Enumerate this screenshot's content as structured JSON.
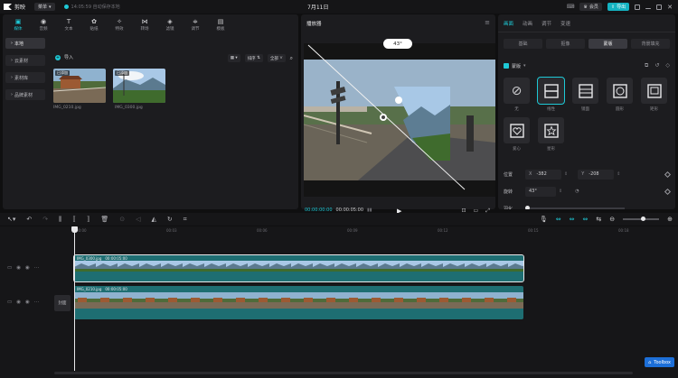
{
  "app": {
    "name": "剪映",
    "menu_label": "菜单",
    "autosave": "14:05:59 自动保存本地",
    "project_title": "7月11日",
    "member_label": "会员",
    "export_label": "导出"
  },
  "media": {
    "tabs": [
      {
        "label": "媒体",
        "glyph": "▣"
      },
      {
        "label": "音频",
        "glyph": "◉"
      },
      {
        "label": "文本",
        "glyph": "T"
      },
      {
        "label": "贴纸",
        "glyph": "✿"
      },
      {
        "label": "特效",
        "glyph": "✧"
      },
      {
        "label": "转场",
        "glyph": "⋈"
      },
      {
        "label": "滤镜",
        "glyph": "◈"
      },
      {
        "label": "调节",
        "glyph": "≑"
      },
      {
        "label": "模板",
        "glyph": "▤"
      }
    ],
    "side_items": [
      "本地",
      "云素材",
      "素材库",
      "品牌素材"
    ],
    "import_label": "导入",
    "tool_sort": "排序",
    "tool_all": "全部",
    "section_all": "全部",
    "files": [
      {
        "name": "IMG_0210.jpg",
        "badge": "已添加"
      },
      {
        "name": "IMG_0300.jpg",
        "badge": "已添加"
      }
    ]
  },
  "player": {
    "title": "播放器",
    "angle_label": "43°",
    "time_current": "00:00:00:00",
    "time_total": "00:00:05:00"
  },
  "inspector": {
    "tabs": [
      "画面",
      "动画",
      "调节",
      "变速"
    ],
    "subtabs": [
      "基础",
      "抠像",
      "蒙版",
      "背景填充"
    ],
    "mask_title": "蒙版",
    "masks": [
      "无",
      "线性",
      "镜面",
      "圆形",
      "矩形",
      "爱心",
      "星形"
    ],
    "position_label": "位置",
    "pos_x_key": "X",
    "pos_x_val": "-382",
    "pos_y_key": "Y",
    "pos_y_val": "-208",
    "rotate_label": "旋转",
    "rotate_val": "43°",
    "feather_label": "羽化"
  },
  "timeline": {
    "ticks": [
      "00:00",
      "00:03",
      "00:06",
      "00:09",
      "00:12",
      "00:15",
      "00:18"
    ],
    "cover_label": "封面",
    "clip_top": {
      "name": "IMG_0300.jpg",
      "duration": "00:00:05:00"
    },
    "clip_bottom": {
      "name": "IMG_0210.jpg",
      "duration": "00:00:05:00"
    },
    "toolbox_label": "Toolbox"
  },
  "colors": {
    "accent": "#1ec9d6",
    "panel": "#1c1c1f",
    "clip_teal": "#1e6e72"
  }
}
